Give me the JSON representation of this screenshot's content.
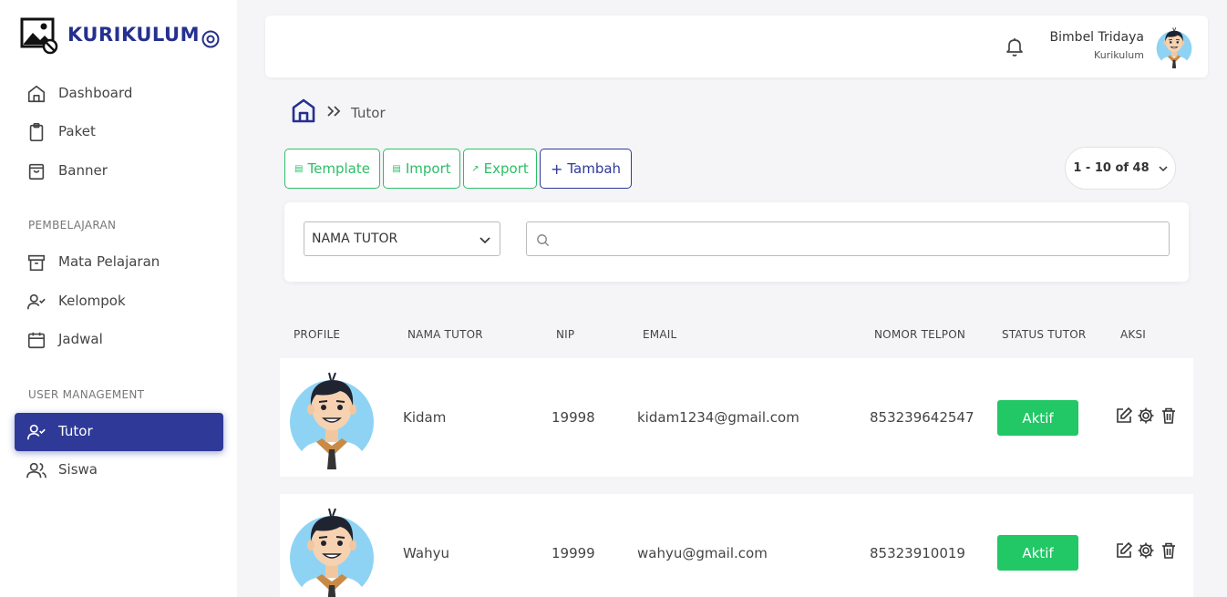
{
  "brand": {
    "title": "KURIKULUM"
  },
  "sidebar": {
    "items": [
      {
        "label": "Dashboard"
      },
      {
        "label": "Paket"
      },
      {
        "label": "Banner"
      }
    ],
    "section_learning": "PEMBELAJARAN",
    "learning_items": [
      {
        "label": "Mata Pelajaran"
      },
      {
        "label": "Kelompok"
      },
      {
        "label": "Jadwal"
      }
    ],
    "section_users": "USER MANAGEMENT",
    "user_items": [
      {
        "label": "Tutor",
        "active": true
      },
      {
        "label": "Siswa"
      }
    ]
  },
  "header": {
    "user_name": "Bimbel Tridaya",
    "user_role": "Kurikulum"
  },
  "breadcrumb": {
    "current": "Tutor"
  },
  "toolbar": {
    "template_label": "Template",
    "import_label": "Import",
    "export_label": "Export",
    "add_label": "Tambah",
    "pagination": "1 - 10 of 48"
  },
  "filter": {
    "field": "NAMA TUTOR",
    "search_value": "",
    "search_placeholder": ""
  },
  "table": {
    "headers": [
      "PROFILE",
      "NAMA TUTOR",
      "NIP",
      "EMAIL",
      "NOMOR TELPON",
      "STATUS TUTOR",
      "AKSI"
    ],
    "rows": [
      {
        "name": "Kidam",
        "nip": "19998",
        "email": "kidam1234@gmail.com",
        "phone": "853239642547",
        "status": "Aktif"
      },
      {
        "name": "Wahyu",
        "nip": "19999",
        "email": "wahyu@gmail.com",
        "phone": "85323910019",
        "status": "Aktif"
      }
    ]
  },
  "colors": {
    "primary": "#2f3a98",
    "success": "#22c766",
    "outline_green": "#2dbf67",
    "background": "#f5f5f7"
  },
  "icons": [
    "image-off-icon",
    "target-icon",
    "home-icon",
    "clipboard-icon",
    "shopping-bag-icon",
    "archive-icon",
    "user-check-icon",
    "calendar-icon",
    "users-icon",
    "bell-icon",
    "chevrons-right-icon",
    "file-icon",
    "external-link-icon",
    "plus-icon",
    "chevron-down-icon",
    "search-icon",
    "edit-icon",
    "settings-icon",
    "trash-icon"
  ]
}
